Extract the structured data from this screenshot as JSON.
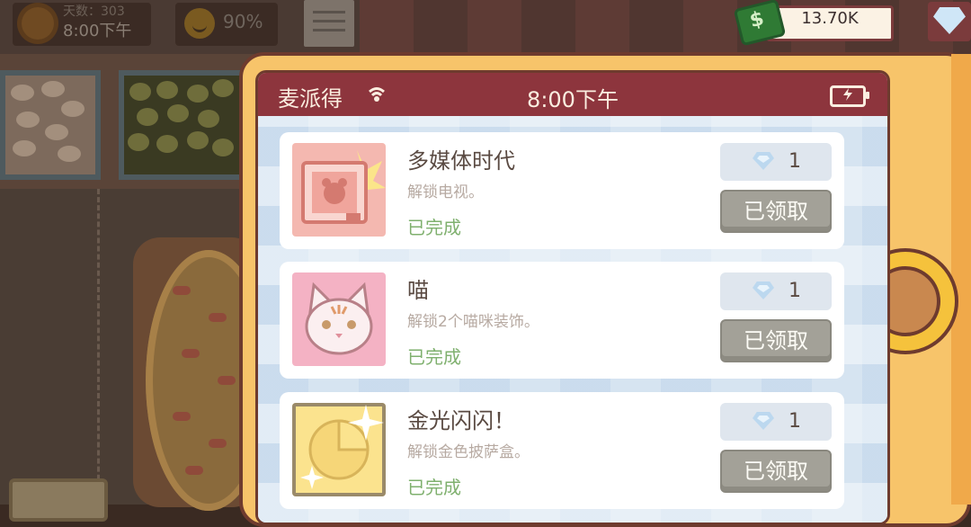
{
  "hud": {
    "day_label": "天数：303",
    "time": "8:00下午",
    "mood_percent": "90%",
    "money": "13.70K"
  },
  "phone": {
    "app_name": "麦派得",
    "clock": "8:00下午"
  },
  "achievements": [
    {
      "title": "多媒体时代",
      "description": "解锁电视。",
      "status": "已完成",
      "reward_count": "1",
      "button_label": "已领取",
      "icon": "tv-icon"
    },
    {
      "title": "喵",
      "description": "解锁2个喵咪装饰。",
      "status": "已完成",
      "reward_count": "1",
      "button_label": "已领取",
      "icon": "cat-icon"
    },
    {
      "title": "金光闪闪！",
      "description": "解锁金色披萨盒。",
      "status": "已完成",
      "reward_count": "1",
      "button_label": "已领取",
      "icon": "gold-pizza-box-icon"
    }
  ],
  "colors": {
    "header": "#8d353d",
    "panel": "#f7c46a",
    "completed": "#7fb06e",
    "claimed_button": "#a3a198"
  }
}
